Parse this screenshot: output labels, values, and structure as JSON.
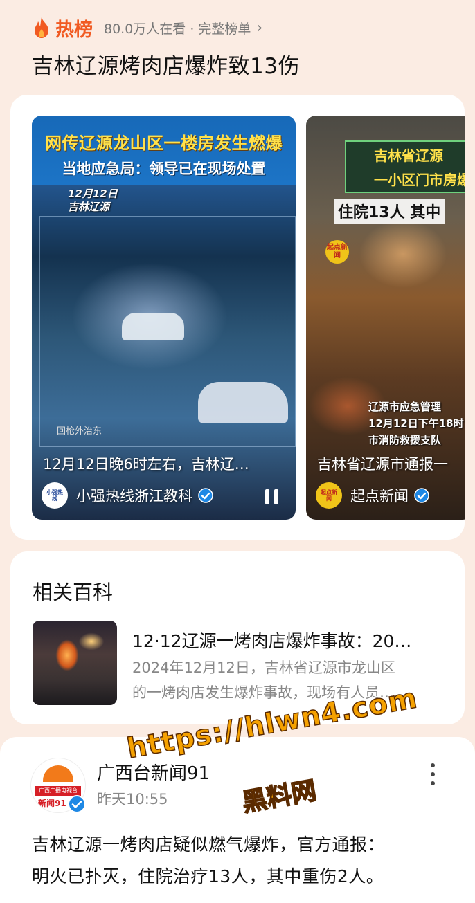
{
  "header": {
    "title": "热榜",
    "meta": "80.0万人在看 · 完整榜单",
    "headline": "吉林辽源烤肉店爆炸致13伤"
  },
  "videos": [
    {
      "banner_line1": "网传辽源龙山区一楼房发生燃爆",
      "banner_line2": "当地应急局：领导已在现场处置",
      "cctv_date_line1": "12月12日",
      "cctv_date_line2": "吉林辽源",
      "cctv_timestamp": "回枪外治东",
      "caption": "12月12日晚6时左右，吉林辽…",
      "author": "小强热线浙江教科",
      "avatar_text": "小强热线",
      "verified": true,
      "playing": true
    },
    {
      "banner_line1": "吉林省辽源",
      "banner_line2": "一小区门市房爆",
      "overlay_title": "住院13人 其中",
      "badge": "起点新闻",
      "overlay_lines": [
        "辽源市应急管理",
        "12月12日下午18时",
        "市消防救援支队"
      ],
      "caption": "吉林省辽源市通报一",
      "author": "起点新闻",
      "avatar_text": "起点新闻",
      "verified": true
    }
  ],
  "wiki": {
    "section_title": "相关百科",
    "item_title": "12·12辽源一烤肉店爆炸事故：20…",
    "desc_line1": "2024年12月12日，吉林省辽源市龙山区",
    "desc_line2": "的一烤肉店发生爆炸事故，现场有人员…"
  },
  "post": {
    "author": "广西台新闻91",
    "time": "昨天10:55",
    "avatar_label": "广西广播电视台",
    "avatar_sub": "新闻91",
    "text_line1": "吉林辽源一烤肉店疑似燃气爆炸，官方通报：",
    "text_line2": "明火已扑灭，住院治疗13人，其中重伤2人。"
  },
  "watermark": {
    "url": "https://hlwn4.com",
    "name": "黑料网"
  },
  "colors": {
    "accent": "#f15a22",
    "page_bg": "#fbece3",
    "verified": "#1e88e5",
    "watermark": "#f5a100"
  },
  "icons": [
    "flame-icon",
    "chevron-right-icon",
    "verified-icon",
    "pause-icon",
    "more-icon"
  ]
}
